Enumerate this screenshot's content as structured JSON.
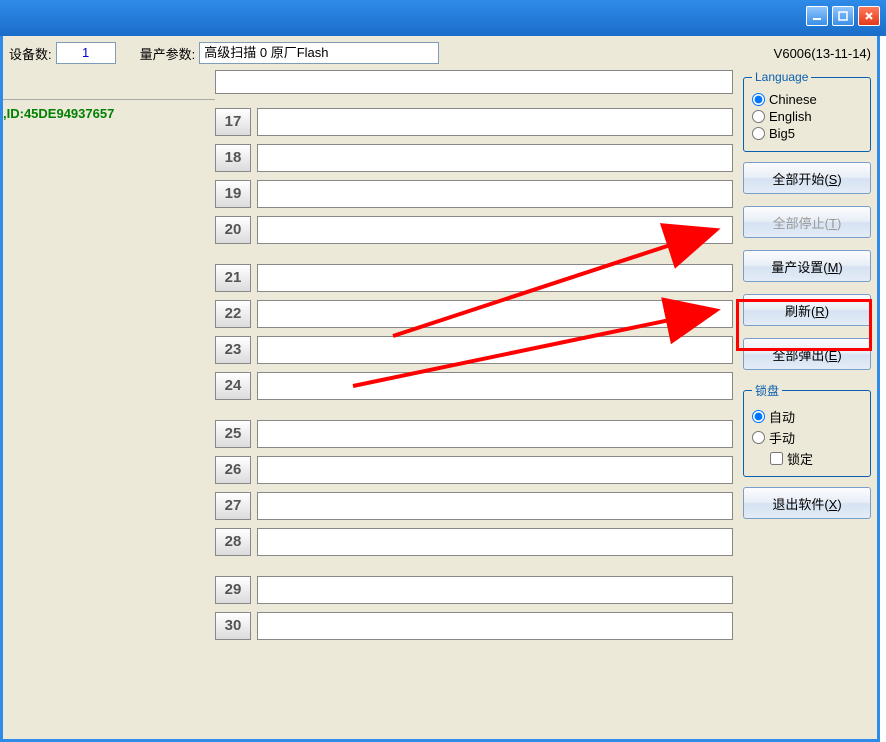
{
  "titlebar": {
    "minimize_title": "minimize",
    "maximize_title": "maximize",
    "close_title": "close"
  },
  "topbar": {
    "device_count_label": "设备数:",
    "device_count": "1",
    "params_label": "量产参数:",
    "params_value": "高级扫描 0 原厂Flash",
    "version": "V6006(13-11-14)"
  },
  "left": {
    "id_text": ",ID:45DE94937657"
  },
  "slots": [
    {
      "num": "17"
    },
    {
      "num": "18"
    },
    {
      "num": "19"
    },
    {
      "num": "20"
    },
    {
      "num": "21"
    },
    {
      "num": "22"
    },
    {
      "num": "23"
    },
    {
      "num": "24"
    },
    {
      "num": "25"
    },
    {
      "num": "26"
    },
    {
      "num": "27"
    },
    {
      "num": "28"
    },
    {
      "num": "29"
    },
    {
      "num": "30"
    }
  ],
  "sidebar": {
    "language_legend": "Language",
    "lang_chinese": "Chinese",
    "lang_english": "English",
    "lang_big5": "Big5",
    "btn_start_all": "全部开始(",
    "btn_start_all_key": "S",
    "btn_start_all_end": ")",
    "btn_stop_all": "全部停止(",
    "btn_stop_all_key": "T",
    "btn_stop_all_end": ")",
    "btn_settings": "量产设置(",
    "btn_settings_key": "M",
    "btn_settings_end": ")",
    "btn_refresh": "刷新(",
    "btn_refresh_key": "R",
    "btn_refresh_end": ")",
    "btn_eject_all": "全部弹出(",
    "btn_eject_all_key": "E",
    "btn_eject_all_end": ")",
    "lock_legend": "锁盘",
    "lock_auto": "自动",
    "lock_manual": "手动",
    "lock_locked": "锁定",
    "btn_exit": "退出软件(",
    "btn_exit_key": "X",
    "btn_exit_end": ")"
  }
}
